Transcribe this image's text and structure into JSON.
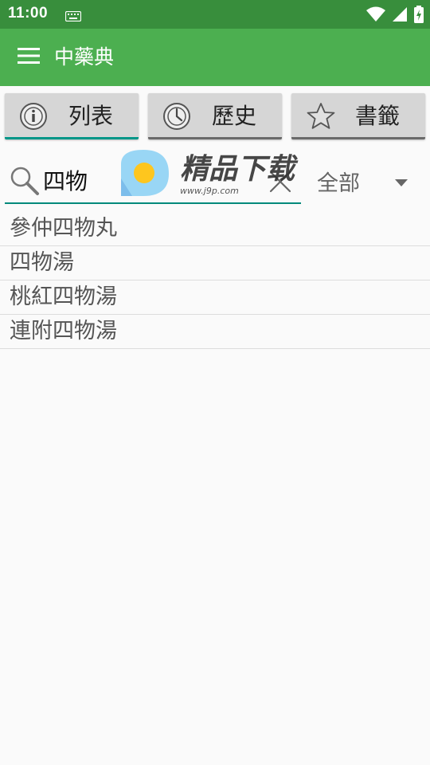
{
  "status_bar": {
    "time": "11:00"
  },
  "app_bar": {
    "title": "中藥典",
    "menu_icon": "hamburger-menu-icon"
  },
  "tabs": [
    {
      "label": "列表",
      "icon": "info-circle-icon",
      "active": true
    },
    {
      "label": "歷史",
      "icon": "clock-icon",
      "active": false
    },
    {
      "label": "書籤",
      "icon": "star-icon",
      "active": false
    }
  ],
  "search": {
    "value": "四物",
    "placeholder": ""
  },
  "filter": {
    "selected": "全部"
  },
  "results": [
    "參仲四物丸",
    "四物湯",
    "桃紅四物湯",
    "連附四物湯"
  ],
  "watermark": {
    "brand": "精品下载",
    "url": "www.j9p.com"
  },
  "colors": {
    "status_bar": "#388e3c",
    "app_bar": "#4caf50",
    "accent": "#009688",
    "tab_background": "#d6d6d6"
  }
}
